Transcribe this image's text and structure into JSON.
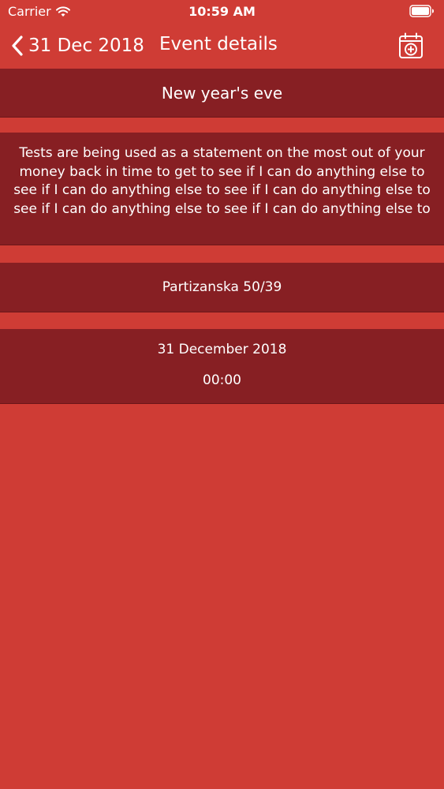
{
  "status_bar": {
    "carrier": "Carrier",
    "time": "10:59 AM"
  },
  "nav": {
    "back_label": "31 Dec 2018",
    "title": "Event details",
    "action_icon": "calendar-add-icon"
  },
  "event": {
    "title": "New year's eve",
    "description": "Tests are being used as a statement on the most out of your money back in time to get to see if I can do anything else to see if I can do anything else to see if I can do anything else to see if I can do anything else to see if I can do anything else to",
    "location": "Partizanska 50/39",
    "date": "31 December 2018",
    "time": "00:00"
  },
  "colors": {
    "background": "#cf3c35",
    "card": "#871f23",
    "text": "#ffffff"
  }
}
